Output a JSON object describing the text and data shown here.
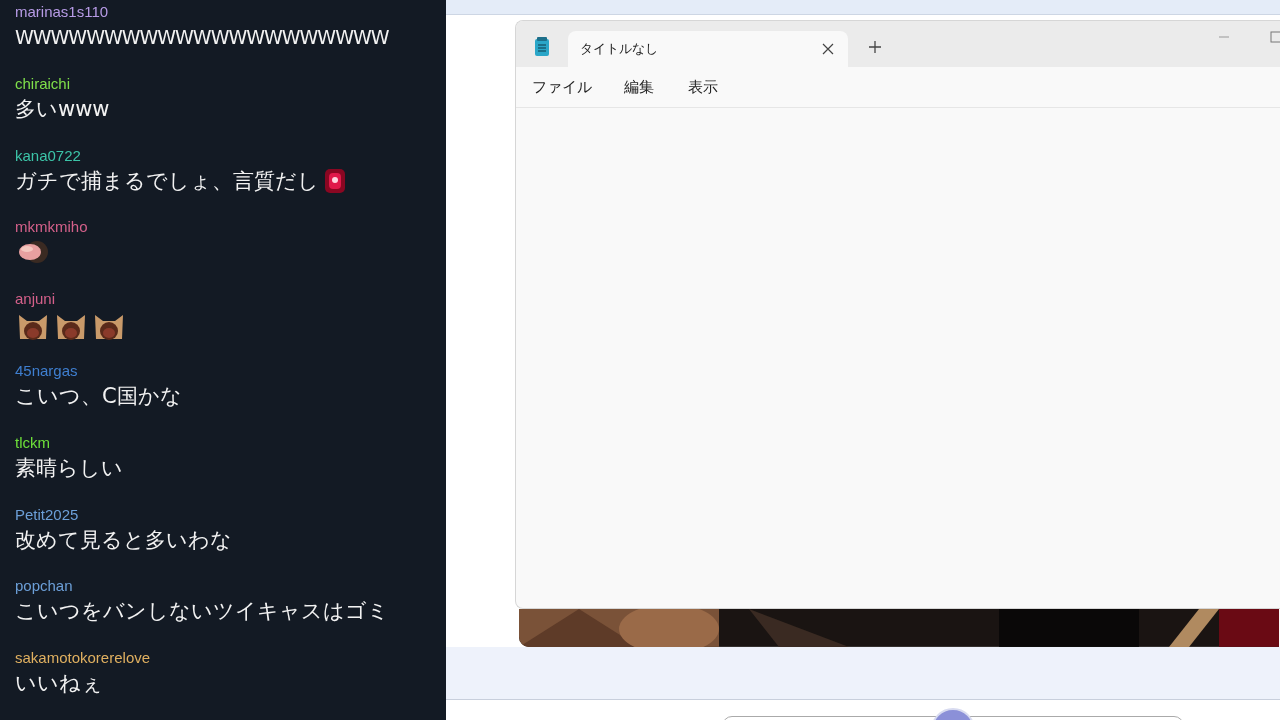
{
  "chat": {
    "messages": [
      {
        "user": "marinas1s110",
        "color": "#b79be6",
        "text": "WWWWWWWWWWWWWWWWWWWWW"
      },
      {
        "user": "chiraichi",
        "color": "#7fe04a",
        "text": "多いwww"
      },
      {
        "user": "kana0722",
        "color": "#3cc4a8",
        "text": "ガチで捕まるでしょ、言質だし",
        "emotes": [
          {
            "kind": "siren"
          }
        ]
      },
      {
        "user": "mkmkmiho",
        "color": "#d4608a",
        "emotes": [
          {
            "kind": "hand"
          }
        ]
      },
      {
        "user": "anjuni",
        "color": "#d4608a",
        "emotes": [
          {
            "kind": "cat"
          },
          {
            "kind": "cat"
          },
          {
            "kind": "cat"
          }
        ]
      },
      {
        "user": "45nargas",
        "color": "#3f7fd0",
        "text": "こいつ、C国かな"
      },
      {
        "user": "tlckm",
        "color": "#6ee03a",
        "text": "素晴らしい"
      },
      {
        "user": "Petit2025",
        "color": "#6c9fd8",
        "text": "改めて見ると多いわな"
      },
      {
        "user": "popchan",
        "color": "#6c9fd8",
        "text": "こいつをバンしないツイキャスはゴミ"
      },
      {
        "user": "sakamotokorerelove",
        "color": "#e0b060",
        "text": "いいねぇ"
      }
    ]
  },
  "notepad": {
    "tab": {
      "title": "タイトルなし",
      "selected": true
    },
    "menu": [
      "ファイル",
      "編集",
      "表示"
    ]
  }
}
